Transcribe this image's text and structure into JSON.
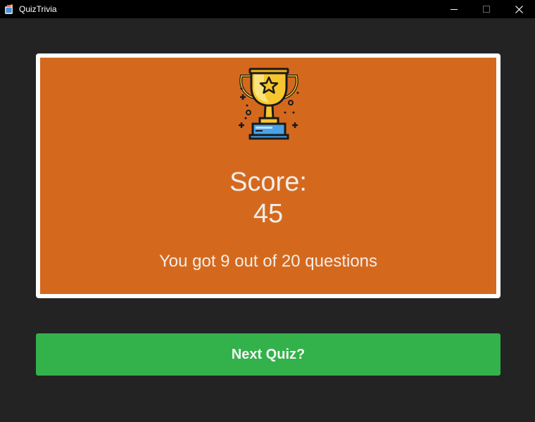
{
  "window": {
    "title": "QuizTrivia",
    "app_icon": "quiz-app-icon",
    "controls": {
      "minimize_icon": "minimize-icon",
      "maximize_icon": "maximize-icon",
      "close_icon": "close-icon"
    }
  },
  "result": {
    "icon": "trophy-icon",
    "score_label": "Score:",
    "score_value": "45",
    "summary": "You got 9 out of 20 questions"
  },
  "actions": {
    "next_label": "Next Quiz?"
  },
  "colors": {
    "background": "#232323",
    "card": "#d4691e",
    "card_border": "#ffffff",
    "button": "#33b24b",
    "text": "#f2ede8"
  }
}
